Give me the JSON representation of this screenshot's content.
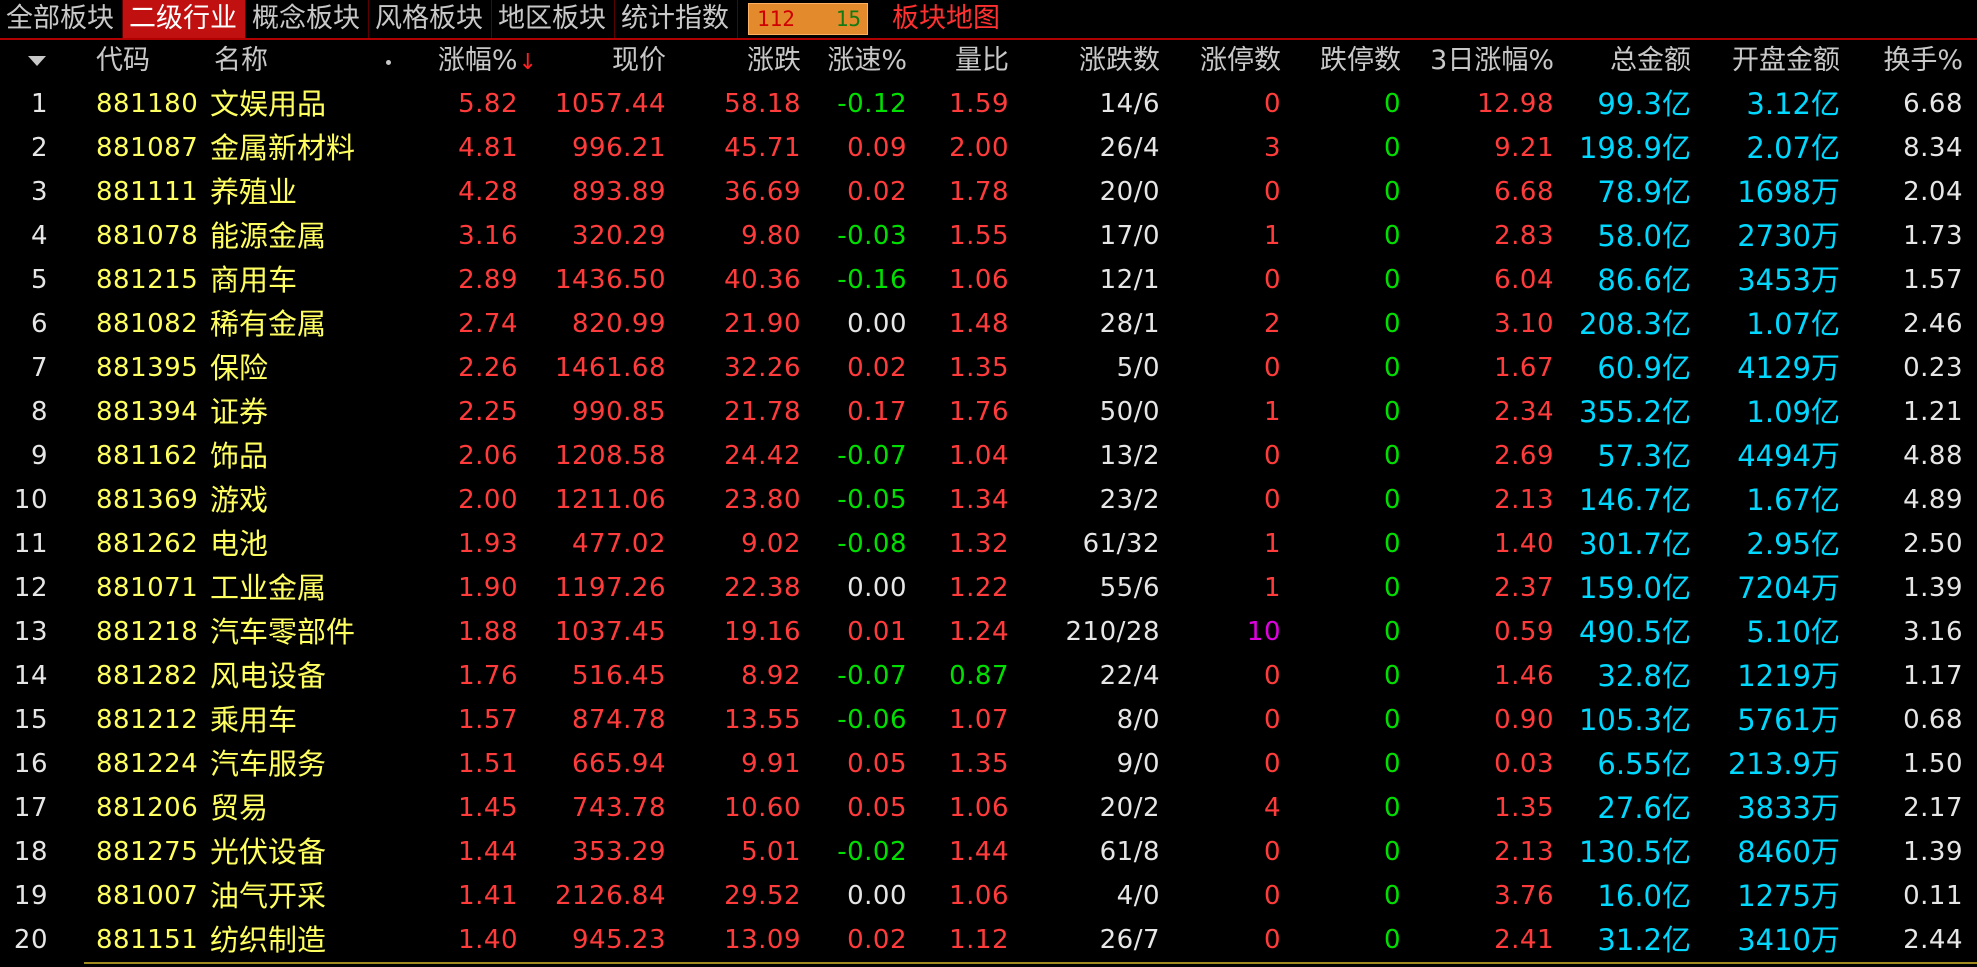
{
  "tabs": [
    {
      "label": "全部板块",
      "active": false
    },
    {
      "label": "二级行业",
      "active": true
    },
    {
      "label": "概念板块",
      "active": false
    },
    {
      "label": "风格板块",
      "active": false
    },
    {
      "label": "地区板块",
      "active": false
    },
    {
      "label": "统计指数",
      "active": false
    }
  ],
  "counter": {
    "up": "112",
    "down": "15"
  },
  "map_link": "板块地图",
  "header": {
    "code": "代码",
    "name": "名称",
    "change_pct": "涨幅%",
    "sort_arrow": "↓",
    "price": "现价",
    "change": "涨跌",
    "speed": "涨速%",
    "volume_ratio": "量比",
    "up_down": "涨跌数",
    "limit_up": "涨停数",
    "limit_down": "跌停数",
    "three_day": "3日涨幅%",
    "total_amount": "总金额",
    "open_amount": "开盘金额",
    "turnover": "换手%"
  },
  "colors": {
    "red": "#ff3b3b",
    "green": "#00e000",
    "yellow": "#ffff60",
    "white": "#e6e6e6",
    "cyan": "#00d8ff",
    "magenta": "#e000e0"
  },
  "rows": [
    {
      "idx": "1",
      "code": "881180",
      "name": "文娱用品",
      "pct": "5.82",
      "price": "1057.44",
      "chg": "58.18",
      "speed": "-0.12",
      "vr": "1.59",
      "updown": "14/6",
      "lu": "0",
      "ld": "0",
      "d3": "12.98",
      "total": "99.3亿",
      "open": "3.12亿",
      "turn": "6.68"
    },
    {
      "idx": "2",
      "code": "881087",
      "name": "金属新材料",
      "pct": "4.81",
      "price": "996.21",
      "chg": "45.71",
      "speed": "0.09",
      "vr": "2.00",
      "updown": "26/4",
      "lu": "3",
      "ld": "0",
      "d3": "9.21",
      "total": "198.9亿",
      "open": "2.07亿",
      "turn": "8.34"
    },
    {
      "idx": "3",
      "code": "881111",
      "name": "养殖业",
      "pct": "4.28",
      "price": "893.89",
      "chg": "36.69",
      "speed": "0.02",
      "vr": "1.78",
      "updown": "20/0",
      "lu": "0",
      "ld": "0",
      "d3": "6.68",
      "total": "78.9亿",
      "open": "1698万",
      "turn": "2.04"
    },
    {
      "idx": "4",
      "code": "881078",
      "name": "能源金属",
      "pct": "3.16",
      "price": "320.29",
      "chg": "9.80",
      "speed": "-0.03",
      "vr": "1.55",
      "updown": "17/0",
      "lu": "1",
      "ld": "0",
      "d3": "2.83",
      "total": "58.0亿",
      "open": "2730万",
      "turn": "1.73"
    },
    {
      "idx": "5",
      "code": "881215",
      "name": "商用车",
      "pct": "2.89",
      "price": "1436.50",
      "chg": "40.36",
      "speed": "-0.16",
      "vr": "1.06",
      "updown": "12/1",
      "lu": "0",
      "ld": "0",
      "d3": "6.04",
      "total": "86.6亿",
      "open": "3453万",
      "turn": "1.57"
    },
    {
      "idx": "6",
      "code": "881082",
      "name": "稀有金属",
      "pct": "2.74",
      "price": "820.99",
      "chg": "21.90",
      "speed": "0.00",
      "vr": "1.48",
      "updown": "28/1",
      "lu": "2",
      "ld": "0",
      "d3": "3.10",
      "total": "208.3亿",
      "open": "1.07亿",
      "turn": "2.46"
    },
    {
      "idx": "7",
      "code": "881395",
      "name": "保险",
      "pct": "2.26",
      "price": "1461.68",
      "chg": "32.26",
      "speed": "0.02",
      "vr": "1.35",
      "updown": "5/0",
      "lu": "0",
      "ld": "0",
      "d3": "1.67",
      "total": "60.9亿",
      "open": "4129万",
      "turn": "0.23"
    },
    {
      "idx": "8",
      "code": "881394",
      "name": "证券",
      "pct": "2.25",
      "price": "990.85",
      "chg": "21.78",
      "speed": "0.17",
      "vr": "1.76",
      "updown": "50/0",
      "lu": "1",
      "ld": "0",
      "d3": "2.34",
      "total": "355.2亿",
      "open": "1.09亿",
      "turn": "1.21"
    },
    {
      "idx": "9",
      "code": "881162",
      "name": "饰品",
      "pct": "2.06",
      "price": "1208.58",
      "chg": "24.42",
      "speed": "-0.07",
      "vr": "1.04",
      "updown": "13/2",
      "lu": "0",
      "ld": "0",
      "d3": "2.69",
      "total": "57.3亿",
      "open": "4494万",
      "turn": "4.88"
    },
    {
      "idx": "10",
      "code": "881369",
      "name": "游戏",
      "pct": "2.00",
      "price": "1211.06",
      "chg": "23.80",
      "speed": "-0.05",
      "vr": "1.34",
      "updown": "23/2",
      "lu": "0",
      "ld": "0",
      "d3": "2.13",
      "total": "146.7亿",
      "open": "1.67亿",
      "turn": "4.89"
    },
    {
      "idx": "11",
      "code": "881262",
      "name": "电池",
      "pct": "1.93",
      "price": "477.02",
      "chg": "9.02",
      "speed": "-0.08",
      "vr": "1.32",
      "updown": "61/32",
      "lu": "1",
      "ld": "0",
      "d3": "1.40",
      "total": "301.7亿",
      "open": "2.95亿",
      "turn": "2.50"
    },
    {
      "idx": "12",
      "code": "881071",
      "name": "工业金属",
      "pct": "1.90",
      "price": "1197.26",
      "chg": "22.38",
      "speed": "0.00",
      "vr": "1.22",
      "updown": "55/6",
      "lu": "1",
      "ld": "0",
      "d3": "2.37",
      "total": "159.0亿",
      "open": "7204万",
      "turn": "1.39"
    },
    {
      "idx": "13",
      "code": "881218",
      "name": "汽车零部件",
      "pct": "1.88",
      "price": "1037.45",
      "chg": "19.16",
      "speed": "0.01",
      "vr": "1.24",
      "updown": "210/28",
      "lu": "10",
      "ld": "0",
      "d3": "0.59",
      "total": "490.5亿",
      "open": "5.10亿",
      "turn": "3.16"
    },
    {
      "idx": "14",
      "code": "881282",
      "name": "风电设备",
      "pct": "1.76",
      "price": "516.45",
      "chg": "8.92",
      "speed": "-0.07",
      "vr": "0.87",
      "updown": "22/4",
      "lu": "0",
      "ld": "0",
      "d3": "1.46",
      "total": "32.8亿",
      "open": "1219万",
      "turn": "1.17"
    },
    {
      "idx": "15",
      "code": "881212",
      "name": "乘用车",
      "pct": "1.57",
      "price": "874.78",
      "chg": "13.55",
      "speed": "-0.06",
      "vr": "1.07",
      "updown": "8/0",
      "lu": "0",
      "ld": "0",
      "d3": "0.90",
      "total": "105.3亿",
      "open": "5761万",
      "turn": "0.68"
    },
    {
      "idx": "16",
      "code": "881224",
      "name": "汽车服务",
      "pct": "1.51",
      "price": "665.94",
      "chg": "9.91",
      "speed": "0.05",
      "vr": "1.35",
      "updown": "9/0",
      "lu": "0",
      "ld": "0",
      "d3": "0.03",
      "total": "6.55亿",
      "open": "213.9万",
      "turn": "1.50"
    },
    {
      "idx": "17",
      "code": "881206",
      "name": "贸易",
      "pct": "1.45",
      "price": "743.78",
      "chg": "10.60",
      "speed": "0.05",
      "vr": "1.06",
      "updown": "20/2",
      "lu": "4",
      "ld": "0",
      "d3": "1.35",
      "total": "27.6亿",
      "open": "3833万",
      "turn": "2.17"
    },
    {
      "idx": "18",
      "code": "881275",
      "name": "光伏设备",
      "pct": "1.44",
      "price": "353.29",
      "chg": "5.01",
      "speed": "-0.02",
      "vr": "1.44",
      "updown": "61/8",
      "lu": "0",
      "ld": "0",
      "d3": "2.13",
      "total": "130.5亿",
      "open": "8460万",
      "turn": "1.39"
    },
    {
      "idx": "19",
      "code": "881007",
      "name": "油气开采",
      "pct": "1.41",
      "price": "2126.84",
      "chg": "29.52",
      "speed": "0.00",
      "vr": "1.06",
      "updown": "4/0",
      "lu": "0",
      "ld": "0",
      "d3": "3.76",
      "total": "16.0亿",
      "open": "1275万",
      "turn": "0.11"
    },
    {
      "idx": "20",
      "code": "881151",
      "name": "纺织制造",
      "pct": "1.40",
      "price": "945.23",
      "chg": "13.09",
      "speed": "0.02",
      "vr": "1.12",
      "updown": "26/7",
      "lu": "0",
      "ld": "0",
      "d3": "2.41",
      "total": "31.2亿",
      "open": "3410万",
      "turn": "2.44"
    }
  ]
}
